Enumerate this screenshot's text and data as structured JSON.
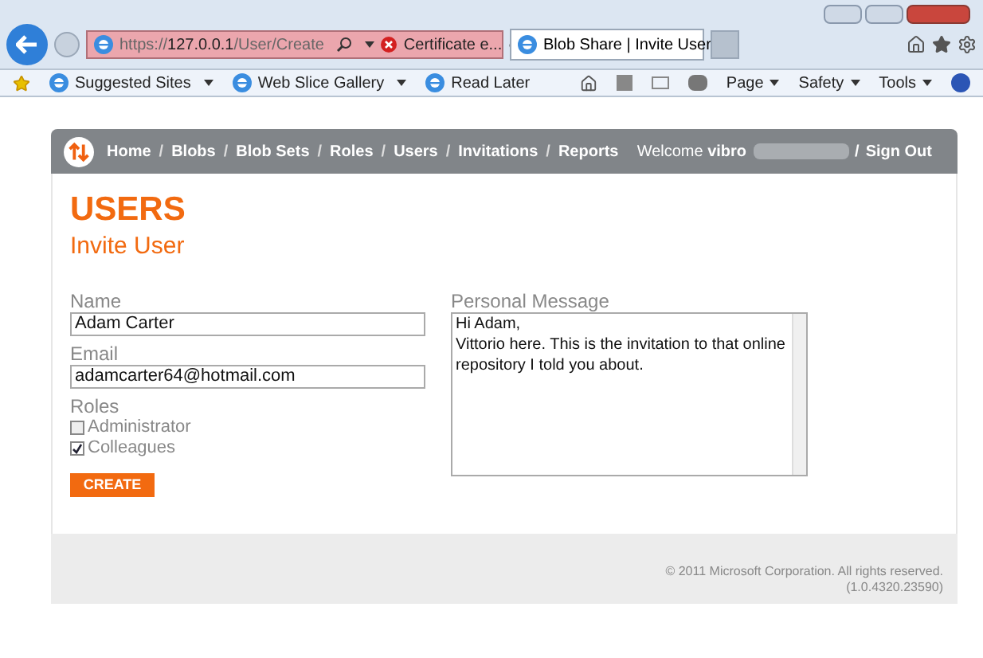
{
  "browser": {
    "address": {
      "scheme": "https://",
      "host": "127.0.0.1",
      "path": "/User/Create"
    },
    "certificate": "Certificate e...",
    "tabs": [
      {
        "label": "Blob Share | Invite User",
        "selected": true
      }
    ],
    "favorites": [
      {
        "label": "Suggested Sites",
        "dropdown": true
      },
      {
        "label": "Web Slice Gallery",
        "dropdown": true
      },
      {
        "label": "Read Later",
        "dropdown": false
      }
    ],
    "commands": [
      "Page",
      "Safety",
      "Tools"
    ]
  },
  "nav": {
    "items": [
      "Home",
      "Blobs",
      "Blob Sets",
      "Roles",
      "Users",
      "Invitations",
      "Reports"
    ],
    "separator": "/",
    "welcome": "Welcome",
    "user": "vibro",
    "sign_out": "Sign Out"
  },
  "page": {
    "title": "USERS",
    "subtitle": "Invite User"
  },
  "form": {
    "fields": [
      {
        "label": "Name",
        "value": "Adam Carter"
      },
      {
        "label": "Email",
        "value": "adamcarter64@hotmail.com"
      }
    ],
    "roles_label": "Roles",
    "roles": [
      {
        "label": "Administrator",
        "checked": false
      },
      {
        "label": "Colleagues",
        "checked": true
      }
    ],
    "message": {
      "label": "Personal Message",
      "value": "Hi Adam,\nVittorio here. This is the invitation to that online repository I told you about."
    },
    "submit": "CREATE"
  },
  "footer": {
    "copyright": "© 2011 Microsoft Corporation. All rights reserved.",
    "version": "(1.0.4320.23590)"
  }
}
